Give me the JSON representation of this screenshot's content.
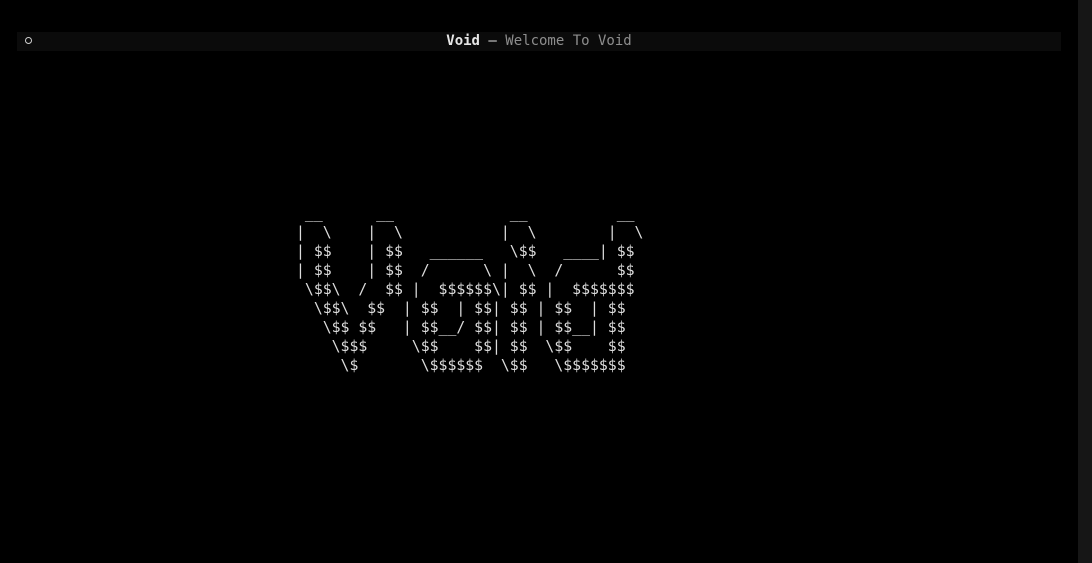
{
  "window": {
    "app_name": "Void",
    "separator": " — ",
    "document_title": "Welcome To Void"
  },
  "icons": {
    "status": "circle-icon"
  },
  "banner": {
    "ascii_art": " __      __             __          __\n|  \\    |  \\           |  \\        |  \\\n| $$    | $$   ______   \\$$   ____| $$\n| $$    | $$  /      \\ |  \\  /      $$\n \\$$\\  /  $$ |  $$$$$$\\| $$ |  $$$$$$$\n  \\$$\\  $$  | $$  | $$| $$ | $$  | $$\n   \\$$ $$   | $$__/ $$| $$ | $$__| $$\n    \\$$$     \\$$    $$| $$  \\$$    $$\n     \\$       \\$$$$$$  \\$$   \\$$$$$$$"
  },
  "colors": {
    "background": "#000000",
    "titlebar": "#0b0b0b",
    "text": "#dcdcdc",
    "muted": "#8e8e8e"
  }
}
